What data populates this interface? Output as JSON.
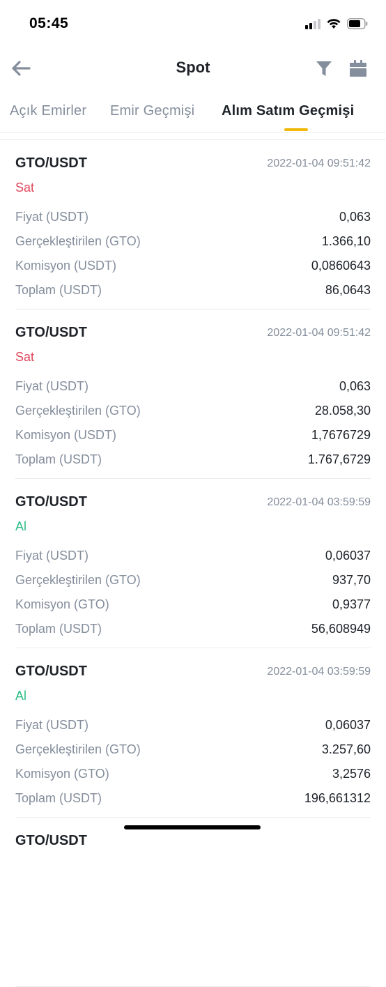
{
  "status_bar": {
    "time": "05:45"
  },
  "nav": {
    "title": "Spot"
  },
  "tabs": [
    {
      "label": "Açık Emirler"
    },
    {
      "label": "Emir Geçmişi"
    },
    {
      "label": "Alım Satım Geçmişi",
      "active": true
    }
  ],
  "colors": {
    "accent": "#f0b90b",
    "sell": "#e0475b",
    "buy": "#2ebd85",
    "muted": "#848e9c"
  },
  "trades": [
    {
      "pair": "GTO/USDT",
      "time": "2022-01-04 09:51:42",
      "side": "Sat",
      "rows": [
        {
          "label": "Fiyat (USDT)",
          "value": "0,063"
        },
        {
          "label": "Gerçekleştirilen (GTO)",
          "value": "1.366,10"
        },
        {
          "label": "Komisyon (USDT)",
          "value": "0,0860643"
        },
        {
          "label": "Toplam (USDT)",
          "value": "86,0643"
        }
      ]
    },
    {
      "pair": "GTO/USDT",
      "time": "2022-01-04 09:51:42",
      "side": "Sat",
      "rows": [
        {
          "label": "Fiyat (USDT)",
          "value": "0,063"
        },
        {
          "label": "Gerçekleştirilen (GTO)",
          "value": "28.058,30"
        },
        {
          "label": "Komisyon (USDT)",
          "value": "1,7676729"
        },
        {
          "label": "Toplam (USDT)",
          "value": "1.767,6729"
        }
      ]
    },
    {
      "pair": "GTO/USDT",
      "time": "2022-01-04 03:59:59",
      "side": "Al",
      "rows": [
        {
          "label": "Fiyat (USDT)",
          "value": "0,06037"
        },
        {
          "label": "Gerçekleştirilen (GTO)",
          "value": "937,70"
        },
        {
          "label": "Komisyon (GTO)",
          "value": "0,9377"
        },
        {
          "label": "Toplam (USDT)",
          "value": "56,608949"
        }
      ]
    },
    {
      "pair": "GTO/USDT",
      "time": "2022-01-04 03:59:59",
      "side": "Al",
      "rows": [
        {
          "label": "Fiyat (USDT)",
          "value": "0,06037"
        },
        {
          "label": "Gerçekleştirilen (GTO)",
          "value": "3.257,60"
        },
        {
          "label": "Komisyon (GTO)",
          "value": "3,2576"
        },
        {
          "label": "Toplam (USDT)",
          "value": "196,661312"
        }
      ]
    },
    {
      "pair": "GTO/USDT"
    }
  ]
}
